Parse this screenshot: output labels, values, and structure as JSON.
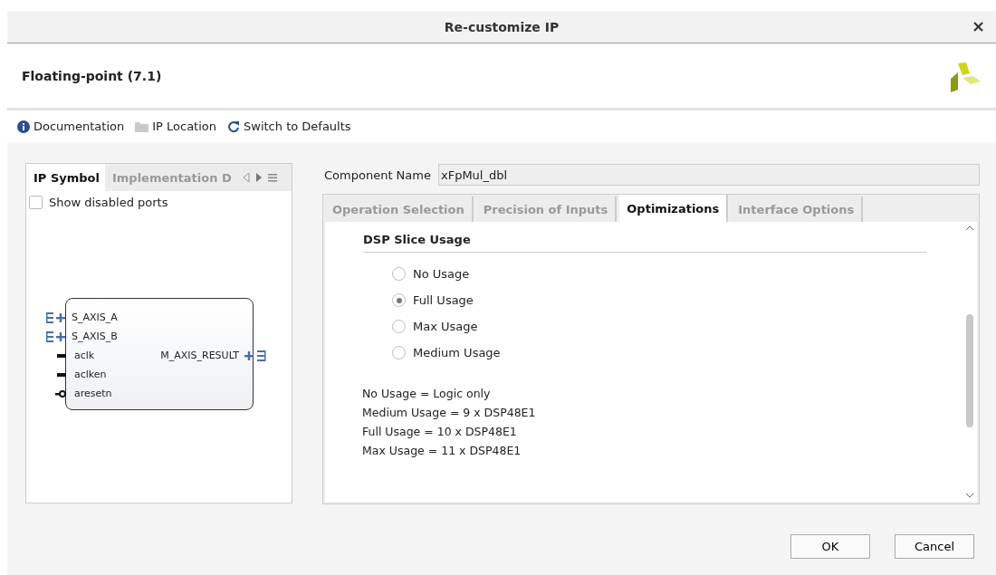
{
  "window": {
    "title": "Re-customize IP",
    "close": "×"
  },
  "header": {
    "title": "Floating-point (7.1)"
  },
  "toolbar": [
    {
      "kind": "info",
      "label": "Documentation"
    },
    {
      "kind": "folder",
      "label": "IP Location"
    },
    {
      "kind": "refresh",
      "label": "Switch to Defaults"
    }
  ],
  "left_panel": {
    "tabs": [
      {
        "label": "IP Symbol",
        "selected": true
      },
      {
        "label": "Implementation D",
        "selected": false
      }
    ],
    "show_disabled_ports": {
      "label": "Show disabled ports",
      "checked": false
    },
    "symbol": {
      "inputs": [
        {
          "kind": "bus",
          "name": "S_AXIS_A"
        },
        {
          "kind": "bus",
          "name": "S_AXIS_B"
        },
        {
          "kind": "wire",
          "name": "aclk"
        },
        {
          "kind": "wire",
          "name": "aclken"
        },
        {
          "kind": "inverted",
          "name": "aresetn"
        }
      ],
      "outputs": [
        {
          "kind": "bus",
          "name": "M_AXIS_RESULT"
        }
      ]
    }
  },
  "component_name": {
    "label": "Component Name",
    "value": "xFpMul_dbl"
  },
  "tabs": [
    {
      "label": "Operation Selection",
      "selected": false
    },
    {
      "label": "Precision of Inputs",
      "selected": false
    },
    {
      "label": "Optimizations",
      "selected": true
    },
    {
      "label": "Interface Options",
      "selected": false
    }
  ],
  "dsp_slice_usage": {
    "title": "DSP Slice Usage",
    "options": [
      {
        "label": "No Usage",
        "selected": false
      },
      {
        "label": "Full Usage",
        "selected": true
      },
      {
        "label": "Max Usage",
        "selected": false
      },
      {
        "label": "Medium Usage",
        "selected": false
      }
    ],
    "notes": [
      "No Usage = Logic only",
      "Medium Usage = 9 x DSP48E1",
      "Full Usage = 10 x DSP48E1",
      "Max Usage = 11 x DSP48E1"
    ]
  },
  "buttons": [
    "OK",
    "Cancel"
  ]
}
